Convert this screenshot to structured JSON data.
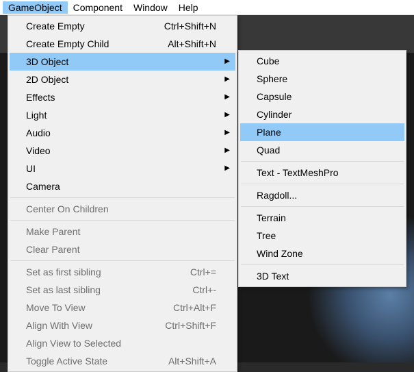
{
  "menubar": {
    "items": [
      {
        "label": "GameObject",
        "active": true
      },
      {
        "label": "Component",
        "active": false
      },
      {
        "label": "Window",
        "active": false
      },
      {
        "label": "Help",
        "active": false
      }
    ]
  },
  "main_menu": [
    {
      "type": "item",
      "label": "Create Empty",
      "shortcut": "Ctrl+Shift+N",
      "submenu": false,
      "disabled": false,
      "highlight": false
    },
    {
      "type": "item",
      "label": "Create Empty Child",
      "shortcut": "Alt+Shift+N",
      "submenu": false,
      "disabled": false,
      "highlight": false
    },
    {
      "type": "item",
      "label": "3D Object",
      "shortcut": "",
      "submenu": true,
      "disabled": false,
      "highlight": true
    },
    {
      "type": "item",
      "label": "2D Object",
      "shortcut": "",
      "submenu": true,
      "disabled": false,
      "highlight": false
    },
    {
      "type": "item",
      "label": "Effects",
      "shortcut": "",
      "submenu": true,
      "disabled": false,
      "highlight": false
    },
    {
      "type": "item",
      "label": "Light",
      "shortcut": "",
      "submenu": true,
      "disabled": false,
      "highlight": false
    },
    {
      "type": "item",
      "label": "Audio",
      "shortcut": "",
      "submenu": true,
      "disabled": false,
      "highlight": false
    },
    {
      "type": "item",
      "label": "Video",
      "shortcut": "",
      "submenu": true,
      "disabled": false,
      "highlight": false
    },
    {
      "type": "item",
      "label": "UI",
      "shortcut": "",
      "submenu": true,
      "disabled": false,
      "highlight": false
    },
    {
      "type": "item",
      "label": "Camera",
      "shortcut": "",
      "submenu": false,
      "disabled": false,
      "highlight": false
    },
    {
      "type": "divider"
    },
    {
      "type": "item",
      "label": "Center On Children",
      "shortcut": "",
      "submenu": false,
      "disabled": true,
      "highlight": false
    },
    {
      "type": "divider"
    },
    {
      "type": "item",
      "label": "Make Parent",
      "shortcut": "",
      "submenu": false,
      "disabled": true,
      "highlight": false
    },
    {
      "type": "item",
      "label": "Clear Parent",
      "shortcut": "",
      "submenu": false,
      "disabled": true,
      "highlight": false
    },
    {
      "type": "divider"
    },
    {
      "type": "item",
      "label": "Set as first sibling",
      "shortcut": "Ctrl+=",
      "submenu": false,
      "disabled": true,
      "highlight": false
    },
    {
      "type": "item",
      "label": "Set as last sibling",
      "shortcut": "Ctrl+-",
      "submenu": false,
      "disabled": true,
      "highlight": false
    },
    {
      "type": "item",
      "label": "Move To View",
      "shortcut": "Ctrl+Alt+F",
      "submenu": false,
      "disabled": true,
      "highlight": false
    },
    {
      "type": "item",
      "label": "Align With View",
      "shortcut": "Ctrl+Shift+F",
      "submenu": false,
      "disabled": true,
      "highlight": false
    },
    {
      "type": "item",
      "label": "Align View to Selected",
      "shortcut": "",
      "submenu": false,
      "disabled": true,
      "highlight": false
    },
    {
      "type": "item",
      "label": "Toggle Active State",
      "shortcut": "Alt+Shift+A",
      "submenu": false,
      "disabled": true,
      "highlight": false
    }
  ],
  "sub_menu": [
    {
      "type": "item",
      "label": "Cube",
      "highlight": false
    },
    {
      "type": "item",
      "label": "Sphere",
      "highlight": false
    },
    {
      "type": "item",
      "label": "Capsule",
      "highlight": false
    },
    {
      "type": "item",
      "label": "Cylinder",
      "highlight": false
    },
    {
      "type": "item",
      "label": "Plane",
      "highlight": true
    },
    {
      "type": "item",
      "label": "Quad",
      "highlight": false
    },
    {
      "type": "divider"
    },
    {
      "type": "item",
      "label": "Text - TextMeshPro",
      "highlight": false
    },
    {
      "type": "divider"
    },
    {
      "type": "item",
      "label": "Ragdoll...",
      "highlight": false
    },
    {
      "type": "divider"
    },
    {
      "type": "item",
      "label": "Terrain",
      "highlight": false
    },
    {
      "type": "item",
      "label": "Tree",
      "highlight": false
    },
    {
      "type": "item",
      "label": "Wind Zone",
      "highlight": false
    },
    {
      "type": "divider"
    },
    {
      "type": "item",
      "label": "3D Text",
      "highlight": false
    }
  ]
}
